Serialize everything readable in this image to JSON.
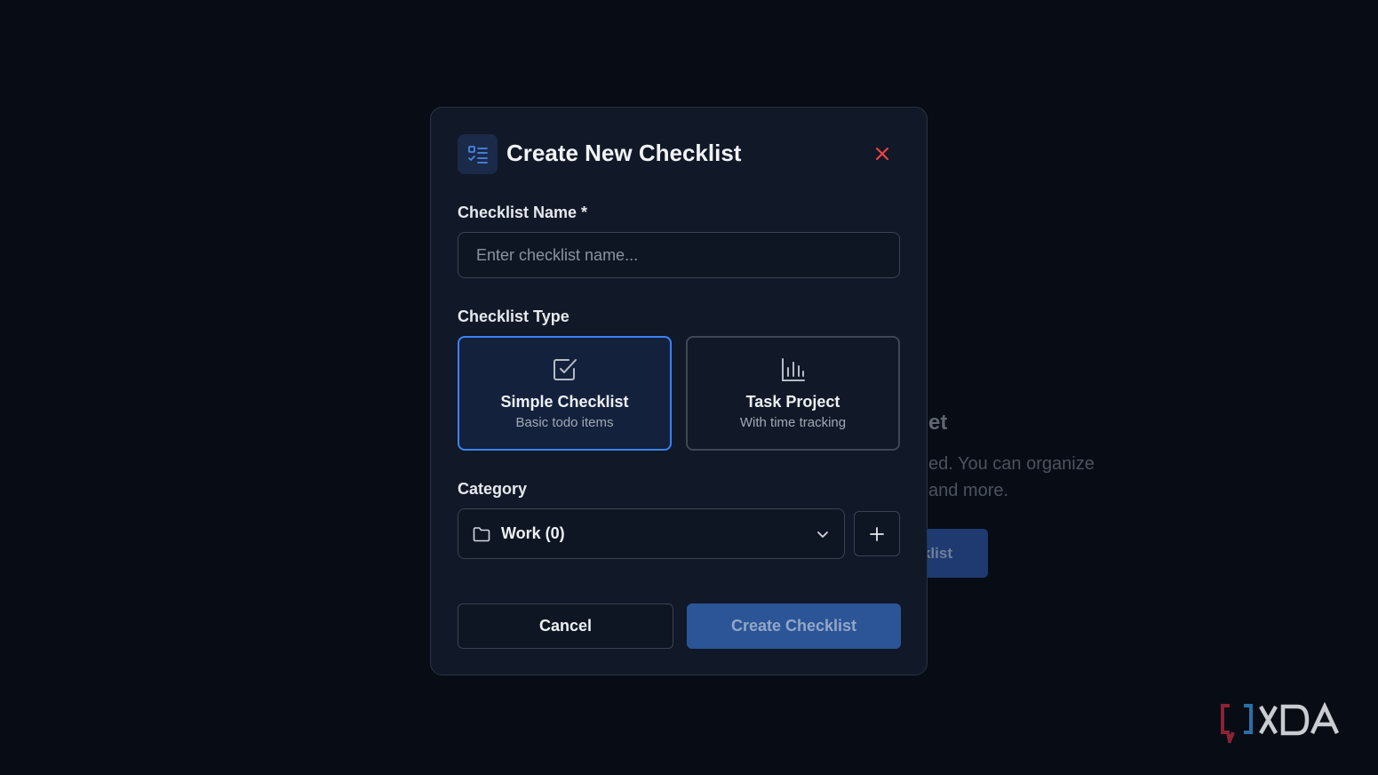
{
  "background": {
    "heading_fragment": "et",
    "description_lines": [
      "ed. You can organize",
      "and more."
    ],
    "button_fragment": "klist"
  },
  "modal": {
    "icon": "list-check-icon",
    "title": "Create New Checklist",
    "close_icon": "close-icon",
    "name_field": {
      "label": "Checklist Name *",
      "value": "",
      "placeholder": "Enter checklist name..."
    },
    "type_field": {
      "label": "Checklist Type",
      "options": [
        {
          "icon": "checkbox-icon",
          "title": "Simple Checklist",
          "subtitle": "Basic todo items",
          "selected": true
        },
        {
          "icon": "bar-chart-icon",
          "title": "Task Project",
          "subtitle": "With time tracking",
          "selected": false
        }
      ]
    },
    "category_field": {
      "label": "Category",
      "selected": "Work (0)",
      "icon": "folder-icon",
      "add_icon": "plus-icon"
    },
    "actions": {
      "cancel_label": "Cancel",
      "create_label": "Create Checklist"
    }
  },
  "colors": {
    "accent": "#3b82f6",
    "close": "#ef4444",
    "primary_button": "#2b5597",
    "background": "#080c14",
    "modal": "#111827"
  },
  "watermark": {
    "text": "XDA"
  }
}
